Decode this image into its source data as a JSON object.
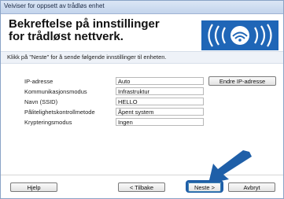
{
  "window": {
    "title": "Veiviser for oppsett av trådløs enhet"
  },
  "header": {
    "title": "Bekreftelse på innstillinger for trådløst nettverk."
  },
  "instruction": "Klikk på \"Neste\" for å sende følgende innstillinger til enheten.",
  "settings": [
    {
      "label": "IP-adresse",
      "value": "Auto"
    },
    {
      "label": "Kommunikasjonsmodus",
      "value": "Infrastruktur"
    },
    {
      "label": "Navn (SSID)",
      "value": "HELLO"
    },
    {
      "label": "Pålitelighetskontrollmetode",
      "value": "Åpent system"
    },
    {
      "label": "Krypteringsmodus",
      "value": "Ingen"
    }
  ],
  "buttons": {
    "change_ip": "Endre IP-adresse",
    "help": "Hjelp",
    "back": "< Tilbake",
    "next": "Neste >",
    "cancel": "Avbryt"
  },
  "colors": {
    "accent": "#1f5fa8",
    "arrow": "#1f5fa8"
  }
}
